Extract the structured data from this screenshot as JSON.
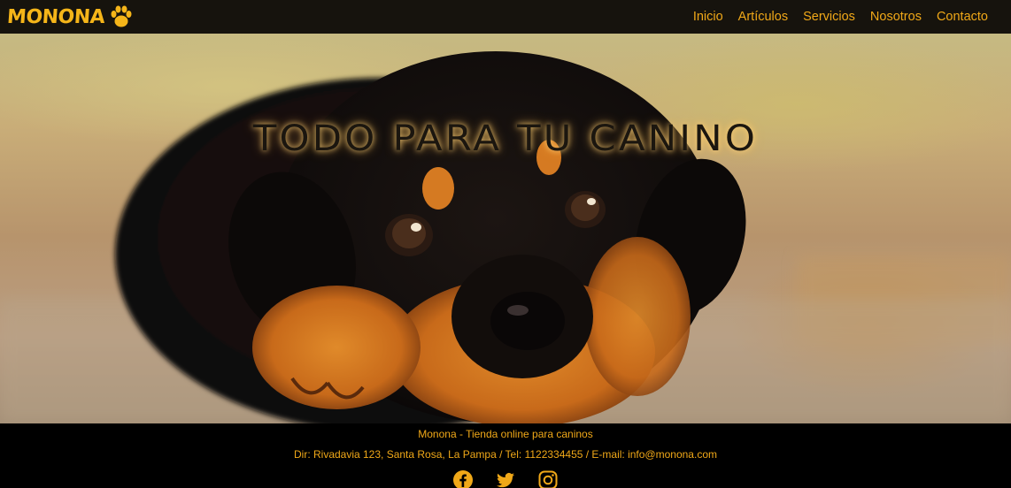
{
  "brand": {
    "name": "MONONA",
    "logo_icon": "paw-icon",
    "color": "#f5b519"
  },
  "nav": {
    "items": [
      {
        "label": "Inicio"
      },
      {
        "label": "Artículos"
      },
      {
        "label": "Servicios"
      },
      {
        "label": "Nosotros"
      },
      {
        "label": "Contacto"
      }
    ]
  },
  "hero": {
    "title": "TODO PARA TU CANINO",
    "image": "rottweiler-puppy-photo"
  },
  "footer": {
    "brand_line": "Monona - Tienda online para caninos",
    "address_line": "Dir: Rivadavia 123, Santa Rosa, La Pampa / Tel: 1122334455 / E-mail: info@monona.com",
    "social_icons": [
      "facebook-icon",
      "twitter-icon",
      "instagram-icon"
    ]
  },
  "colors": {
    "accent": "#f0a818",
    "navbar_bg": "#16130d",
    "footer_bg": "#000000"
  }
}
